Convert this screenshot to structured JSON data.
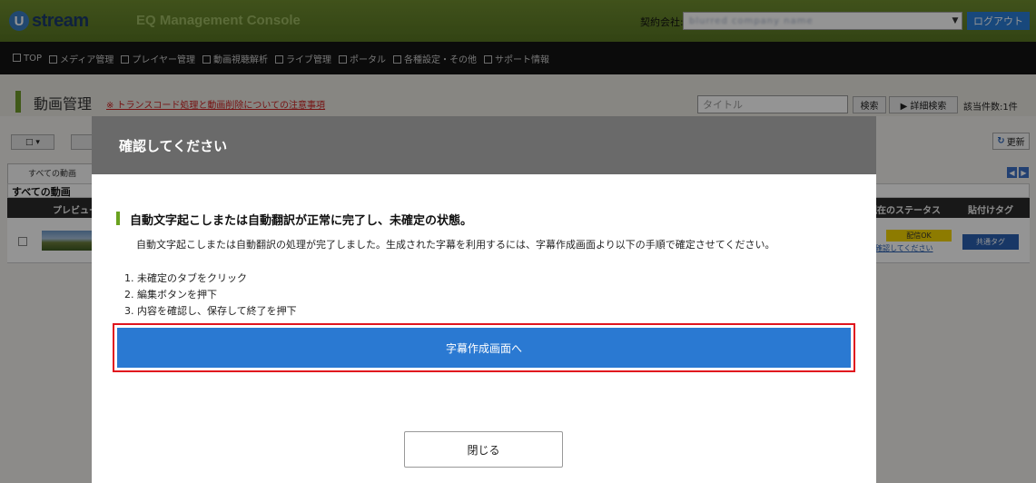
{
  "header": {
    "logo_mark": "U",
    "logo_text": "stream",
    "app_title": "EQ Management Console",
    "company_label": "契約会社:",
    "company_value": "blurred company name",
    "logout_label": "ログアウト"
  },
  "nav": {
    "items": [
      "TOP",
      "メディア管理",
      "プレイヤー管理",
      "動画視聴解析",
      "ライブ管理",
      "ポータル",
      "各種設定・その他",
      "サポート情報"
    ]
  },
  "page": {
    "title": "動画管理",
    "notice_link": "※ トランスコード処理と動画削除についての注意事項",
    "search_placeholder": "タイトル",
    "search_label": "検索",
    "advanced_search_label": "▶ 詳細検索",
    "hit_count": "該当件数:1件"
  },
  "list": {
    "tab_label": "すべての動画",
    "title": "すべての動画",
    "columns": {
      "preview": "プレビュー",
      "status": "現在のステータス",
      "embed": "貼付けタグ"
    },
    "refresh_label": "更新",
    "row": {
      "status_badge": "配信OK",
      "status_link": "確認してください",
      "embed_button": "共通タグ"
    }
  },
  "modal": {
    "title": "確認してください",
    "section_title": "自動文字起こしまたは自動翻訳が正常に完了し、未確定の状態。",
    "description": "自動文字起こしまたは自動翻訳の処理が完了しました。生成された字幕を利用するには、字幕作成画面より以下の手順で確定させてください。",
    "steps": [
      "1. 未確定のタブをクリック",
      "2. 編集ボタンを押下",
      "3. 内容を確認し、保存して終了を押下"
    ],
    "primary_button": "字幕作成画面へ",
    "close_button": "閉じる"
  },
  "colors": {
    "header_green": "#6f8d2f",
    "primary_blue": "#2a79d2",
    "highlight_red": "#e0141e",
    "section_bar_green": "#6aa21f"
  }
}
